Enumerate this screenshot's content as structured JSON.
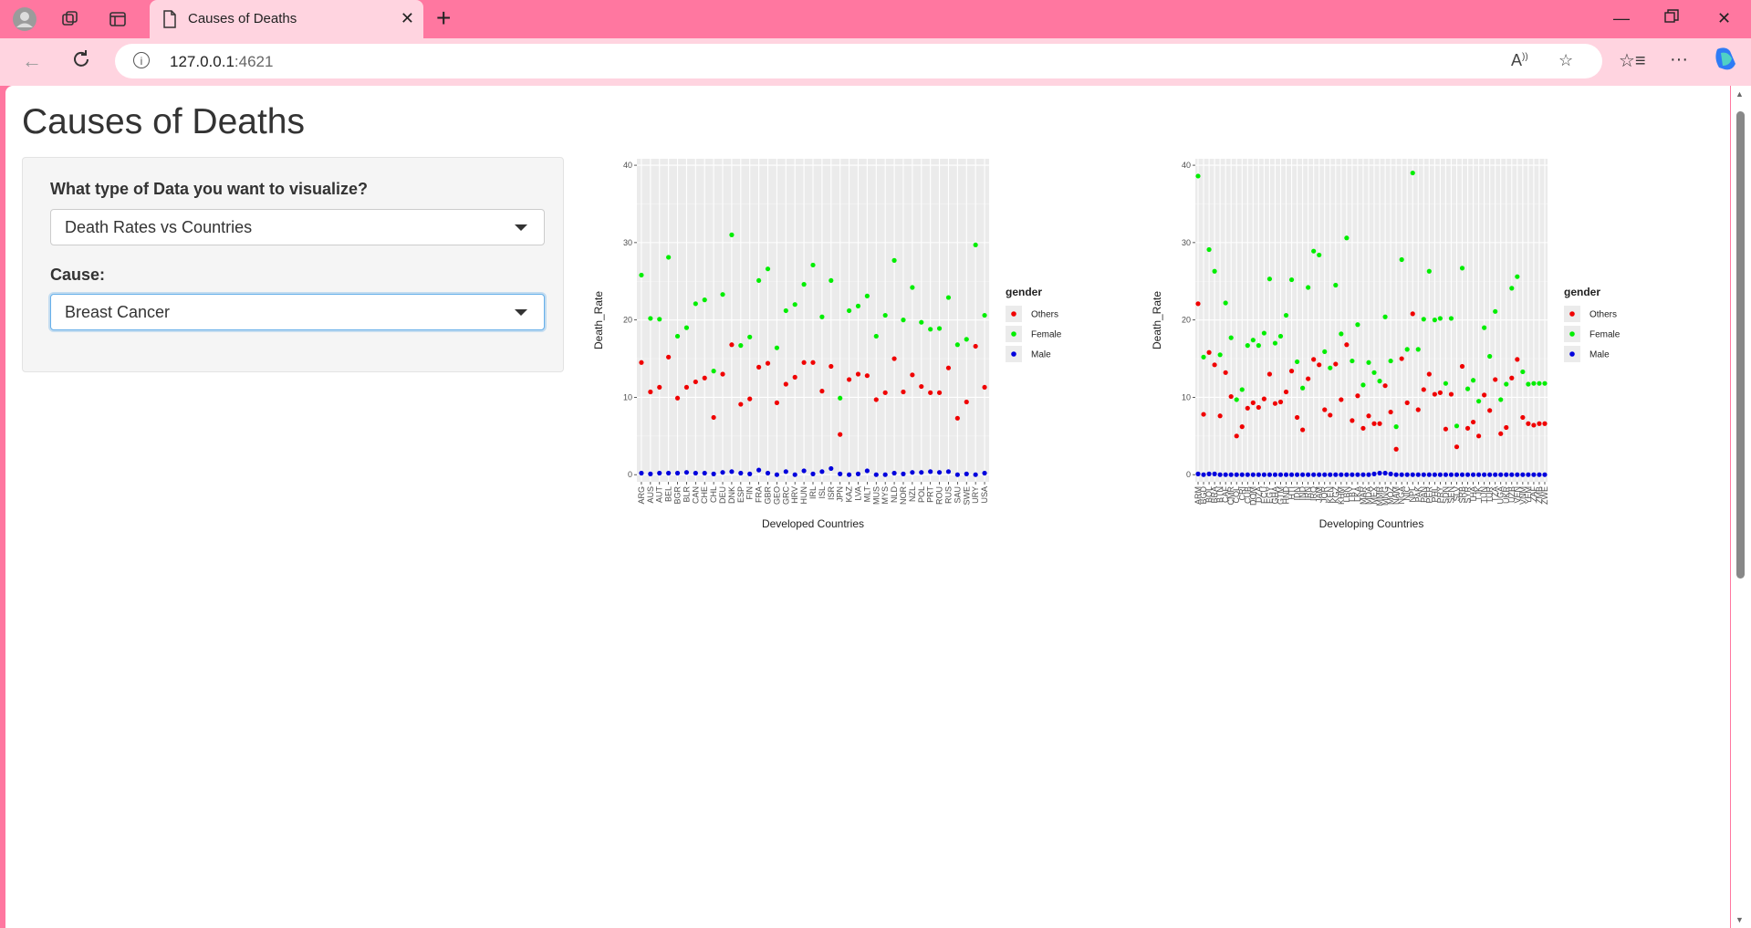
{
  "browser": {
    "tab_title": "Causes of Deaths",
    "url_host": "127.0.0.1",
    "url_port": ":4621"
  },
  "page": {
    "title": "Causes of Deaths",
    "form": {
      "type_label": "What type of Data you want to visualize?",
      "type_value": "Death Rates vs Countries",
      "cause_label": "Cause:",
      "cause_value": "Breast Cancer"
    }
  },
  "colors": {
    "Others": "#f00000",
    "Female": "#00ee00",
    "Male": "#0000dd",
    "panel_bg": "#ebebeb"
  },
  "chart_data": [
    {
      "type": "scatter",
      "xlabel": "Developed Countries",
      "ylabel": "Death_Rate",
      "ylim": [
        0,
        40
      ],
      "yticks": [
        0,
        10,
        20,
        30,
        40
      ],
      "legend_title": "gender",
      "legend_position": "right",
      "categories": [
        "ARG",
        "AUS",
        "AUT",
        "BEL",
        "BGR",
        "BLR",
        "CAN",
        "CHE",
        "CHL",
        "DEU",
        "DNK",
        "ESP",
        "FIN",
        "FRA",
        "GBR",
        "GEO",
        "GRC",
        "HRV",
        "HUN",
        "IRL",
        "ISL",
        "ISR",
        "JPN",
        "KAZ",
        "LVA",
        "MLT",
        "MUS",
        "MYS",
        "NLD",
        "NOR",
        "NZL",
        "POL",
        "PRT",
        "ROU",
        "RUS",
        "SAU",
        "SWE",
        "URY",
        "USA"
      ],
      "series": [
        {
          "name": "Others",
          "values": [
            14.5,
            10.7,
            11.3,
            15.2,
            9.9,
            11.3,
            12.0,
            12.5,
            7.4,
            13.0,
            16.8,
            9.1,
            9.8,
            13.9,
            14.4,
            9.3,
            11.7,
            12.6,
            14.5,
            14.5,
            10.8,
            14.0,
            5.2,
            12.3,
            13.0,
            12.8,
            9.7,
            10.6,
            15.0,
            10.7,
            12.9,
            11.4,
            10.6,
            10.6,
            13.8,
            7.3,
            9.4,
            16.6,
            11.3
          ]
        },
        {
          "name": "Female",
          "values": [
            25.8,
            20.2,
            20.1,
            28.1,
            17.9,
            19.0,
            22.1,
            22.6,
            13.4,
            23.3,
            31.0,
            16.7,
            17.8,
            25.1,
            26.6,
            16.4,
            21.2,
            22.0,
            24.6,
            27.1,
            20.4,
            25.1,
            9.9,
            21.2,
            21.8,
            23.1,
            17.9,
            20.6,
            27.7,
            20.0,
            24.2,
            19.7,
            18.8,
            18.9,
            22.9,
            16.8,
            17.5,
            29.7,
            20.6
          ]
        },
        {
          "name": "Male",
          "values": [
            0.2,
            0.1,
            0.2,
            0.2,
            0.2,
            0.3,
            0.2,
            0.2,
            0.1,
            0.3,
            0.4,
            0.2,
            0.1,
            0.6,
            0.2,
            0.0,
            0.4,
            0.0,
            0.5,
            0.1,
            0.4,
            0.8,
            0.1,
            0.0,
            0.1,
            0.5,
            0.0,
            0.0,
            0.2,
            0.1,
            0.3,
            0.3,
            0.4,
            0.3,
            0.4,
            0.0,
            0.1,
            0.0,
            0.2
          ]
        }
      ]
    },
    {
      "type": "scatter",
      "xlabel": "Developing Countries",
      "ylabel": "Death_Rate",
      "ylim": [
        0,
        40
      ],
      "yticks": [
        0,
        10,
        20,
        30,
        40
      ],
      "legend_title": "gender",
      "legend_position": "right",
      "categories": [
        "ARM",
        "BGD",
        "BOL",
        "BRA",
        "BTN",
        "CAF",
        "CMR",
        "COL",
        "CRI",
        "CUB",
        "DOM",
        "DZA",
        "ECU",
        "EGY",
        "GHA",
        "GTM",
        "HND",
        "HTI",
        "IDN",
        "IND",
        "IRN",
        "IRQ",
        "JAM",
        "JOR",
        "KEN",
        "KGZ",
        "KHM",
        "LBN",
        "LBY",
        "LKA",
        "MAR",
        "MDA",
        "MEX",
        "MMR",
        "MNG",
        "MOZ",
        "NAM",
        "NGA",
        "NIC",
        "NPL",
        "PAK",
        "PAN",
        "PER",
        "PHL",
        "PRY",
        "SDN",
        "SEN",
        "SLV",
        "SRB",
        "SYR",
        "THA",
        "TJK",
        "TUN",
        "TUR",
        "TZA",
        "UGA",
        "UKR",
        "UZB",
        "VEN",
        "VNM",
        "YEM",
        "ZAF",
        "ZMB",
        "ZWE"
      ],
      "series": [
        {
          "name": "Others",
          "values": [
            22.1,
            7.8,
            15.8,
            14.2,
            7.6,
            13.2,
            10.1,
            5.0,
            6.2,
            8.6,
            9.3,
            8.7,
            9.8,
            13.0,
            9.2,
            9.4,
            10.7,
            13.4,
            7.4,
            5.8,
            12.4,
            14.9,
            14.2,
            8.4,
            7.7,
            14.3,
            9.7,
            16.8,
            7.0,
            10.2,
            6.0,
            7.6,
            6.6,
            6.6,
            11.5,
            8.1,
            3.3,
            15.0,
            9.3,
            20.8,
            8.4,
            11.0,
            13.0,
            10.4,
            10.6,
            5.9,
            10.4,
            3.6,
            14.0,
            6.0,
            6.8,
            5.0,
            10.3,
            8.3,
            12.3,
            5.3,
            6.1,
            12.5,
            14.9,
            7.4,
            6.6,
            6.4,
            6.6,
            6.6
          ]
        },
        {
          "name": "Female",
          "values": [
            38.6,
            15.2,
            29.1,
            26.3,
            15.5,
            22.2,
            17.7,
            9.7,
            11.0,
            16.7,
            17.4,
            16.7,
            18.3,
            25.3,
            17.0,
            17.9,
            20.6,
            25.2,
            14.6,
            11.2,
            24.2,
            28.9,
            28.4,
            15.9,
            13.8,
            24.5,
            18.2,
            30.6,
            14.7,
            19.4,
            11.6,
            14.5,
            13.2,
            12.1,
            20.4,
            14.7,
            6.2,
            27.8,
            16.2,
            39.0,
            16.2,
            20.1,
            26.3,
            20.0,
            20.2,
            11.8,
            20.2,
            6.3,
            26.7,
            11.1,
            12.2,
            9.5,
            19.0,
            15.3,
            21.1,
            9.7,
            11.7,
            24.1,
            25.6,
            13.3,
            11.7,
            11.8,
            11.8,
            11.8
          ]
        },
        {
          "name": "Male",
          "values": [
            0.1,
            0.0,
            0.1,
            0.1,
            0.0,
            0.0,
            0.0,
            0.0,
            0.0,
            0.0,
            0.0,
            0.0,
            0.0,
            0.0,
            0.0,
            0.0,
            0.0,
            0.0,
            0.0,
            0.0,
            0.0,
            0.0,
            0.0,
            0.0,
            0.0,
            0.0,
            0.0,
            0.0,
            0.0,
            0.0,
            0.0,
            0.0,
            0.1,
            0.2,
            0.2,
            0.1,
            0.0,
            0.0,
            0.0,
            0.0,
            0.0,
            0.0,
            0.0,
            0.0,
            0.0,
            0.0,
            0.0,
            0.0,
            0.0,
            0.0,
            0.0,
            0.0,
            0.0,
            0.0,
            0.0,
            0.0,
            0.0,
            0.0,
            0.0,
            0.0,
            0.0,
            0.0,
            0.0,
            0.0
          ]
        }
      ]
    }
  ]
}
